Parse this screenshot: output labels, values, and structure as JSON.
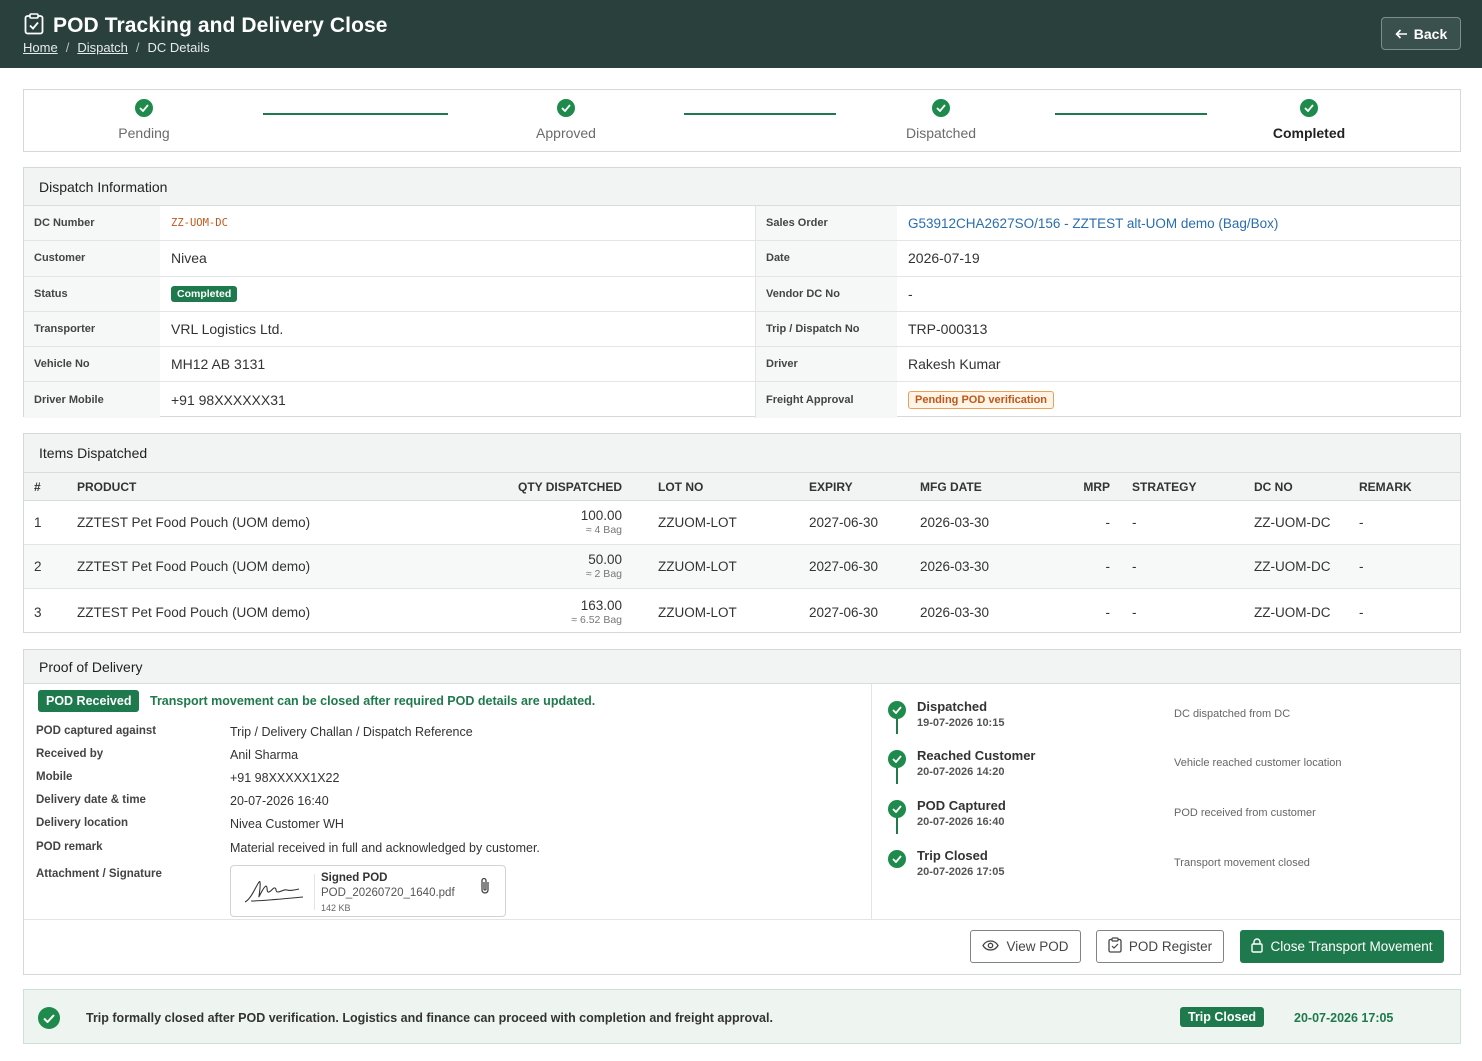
{
  "header": {
    "title": "POD Tracking and Delivery Close",
    "breadcrumb": [
      "Home",
      "Dispatch",
      "DC Details"
    ],
    "back_label": "Back"
  },
  "stepper": [
    {
      "label": "Pending",
      "done": true
    },
    {
      "label": "Approved",
      "done": true
    },
    {
      "label": "Dispatched",
      "done": true
    },
    {
      "label": "Completed",
      "done": true,
      "current": true
    }
  ],
  "dispatch": {
    "heading": "Dispatch Information",
    "fields": {
      "dc_number_label": "DC Number",
      "dc_number": "ZZ-UOM-DC",
      "sales_order_label": "Sales Order",
      "sales_order": "G53912CHA2627SO/156 - ZZTEST alt-UOM demo (Bag/Box)",
      "customer_label": "Customer",
      "customer": "Nivea",
      "date_label": "Date",
      "date": "2026-07-19",
      "status_label": "Status",
      "status": "Completed",
      "vendor_dc_label": "Vendor DC No",
      "vendor_dc": "-",
      "transporter_label": "Transporter",
      "transporter": "VRL Logistics Ltd.",
      "trip_label": "Trip / Dispatch No",
      "trip": "TRP-000313",
      "vehicle_label": "Vehicle No",
      "vehicle": "MH12 AB 3131",
      "driver_label": "Driver",
      "driver": "Rakesh Kumar",
      "driver_mobile_label": "Driver Mobile",
      "driver_mobile": "+91 98XXXXXX31",
      "freight_label": "Freight Approval",
      "freight": "Pending POD verification"
    }
  },
  "items": {
    "heading": "Items Dispatched",
    "columns": [
      "#",
      "PRODUCT",
      "QTY DISPATCHED",
      "LOT NO",
      "EXPIRY",
      "MFG DATE",
      "MRP",
      "STRATEGY",
      "DC NO",
      "REMARK"
    ],
    "rows": [
      {
        "no": "1",
        "product": "ZZTEST Pet Food Pouch (UOM demo)",
        "qty": "100.00",
        "qty_alt": "≈ 4 Bag",
        "lot": "ZZUOM-LOT",
        "expiry": "2027-06-30",
        "mfg": "2026-03-30",
        "mrp": "-",
        "strategy": "-",
        "dc_no": "ZZ-UOM-DC",
        "remark": "-"
      },
      {
        "no": "2",
        "product": "ZZTEST Pet Food Pouch (UOM demo)",
        "qty": "50.00",
        "qty_alt": "≈ 2 Bag",
        "lot": "ZZUOM-LOT",
        "expiry": "2027-06-30",
        "mfg": "2026-03-30",
        "mrp": "-",
        "strategy": "-",
        "dc_no": "ZZ-UOM-DC",
        "remark": "-"
      },
      {
        "no": "3",
        "product": "ZZTEST Pet Food Pouch (UOM demo)",
        "qty": "163.00",
        "qty_alt": "≈ 6.52 Bag",
        "lot": "ZZUOM-LOT",
        "expiry": "2027-06-30",
        "mfg": "2026-03-30",
        "mrp": "-",
        "strategy": "-",
        "dc_no": "ZZ-UOM-DC",
        "remark": "-"
      }
    ]
  },
  "pod": {
    "heading": "Proof of Delivery",
    "badge": "POD Received",
    "message": "Transport movement can be closed after required POD details are updated.",
    "fields": [
      {
        "label": "POD captured against",
        "value": "Trip / Delivery Challan / Dispatch Reference"
      },
      {
        "label": "Received by",
        "value": "Anil Sharma"
      },
      {
        "label": "Mobile",
        "value": "+91 98XXXXX1X22"
      },
      {
        "label": "Delivery date & time",
        "value": "20-07-2026 16:40"
      },
      {
        "label": "Delivery location",
        "value": "Nivea Customer WH"
      },
      {
        "label": "POD remark",
        "value": "Material received in full and acknowledged by customer."
      }
    ],
    "attachment_label": "Attachment / Signature",
    "attachment": {
      "title": "Signed POD",
      "file": "POD_20260720_1640.pdf",
      "size": "142 KB"
    },
    "timeline": [
      {
        "name": "Dispatched",
        "time": "19-07-2026 10:15",
        "desc": "DC dispatched from DC"
      },
      {
        "name": "Reached Customer",
        "time": "20-07-2026 14:20",
        "desc": "Vehicle reached customer location"
      },
      {
        "name": "POD Captured",
        "time": "20-07-2026 16:40",
        "desc": "POD received from customer"
      },
      {
        "name": "Trip Closed",
        "time": "20-07-2026 17:05",
        "desc": "Transport movement closed"
      }
    ],
    "actions": {
      "view": "View POD",
      "register": "POD Register",
      "close": "Close Transport Movement"
    }
  },
  "footer": {
    "message": "Trip formally closed after POD verification. Logistics and finance can proceed with completion and freight approval.",
    "badge": "Trip Closed",
    "datetime": "20-07-2026 17:05"
  },
  "colors": {
    "primary": "#1e7a4c",
    "header_bg": "#29403c",
    "link": "#2a6db0",
    "warning": "#c0571b"
  },
  "icons": [
    "clipboard-check-icon",
    "arrow-left-icon",
    "check-circle-icon",
    "paperclip-icon",
    "eye-icon",
    "clipboard-icon",
    "lock-icon",
    "signature-image"
  ]
}
